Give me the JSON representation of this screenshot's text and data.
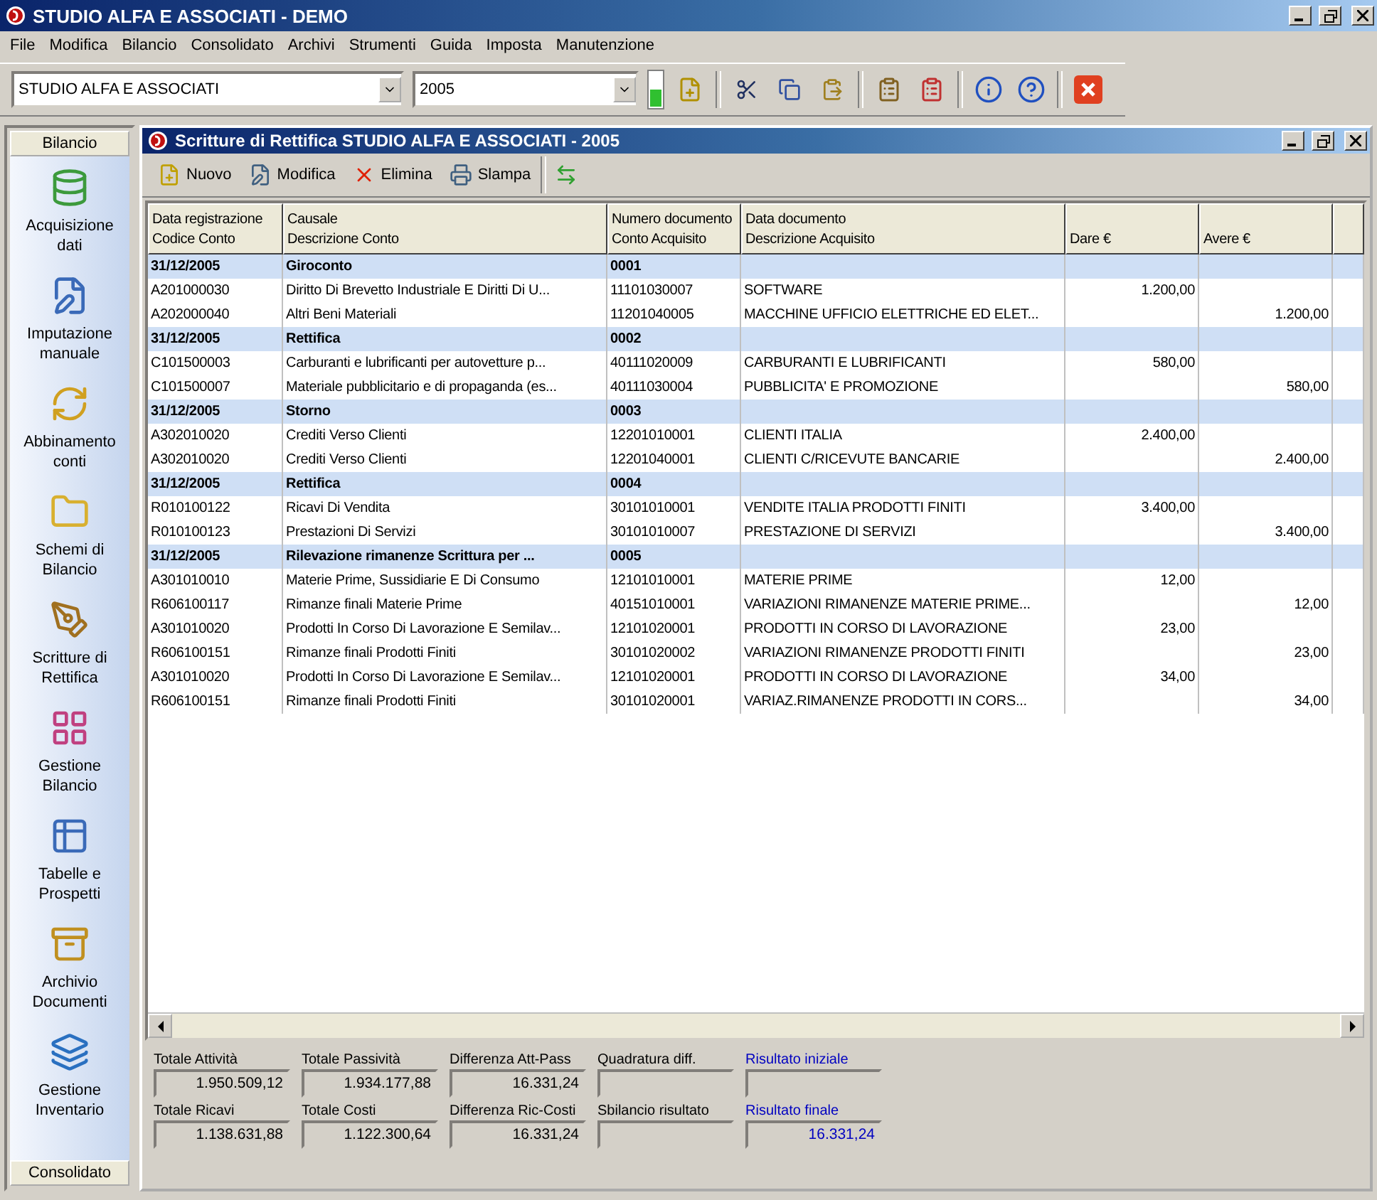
{
  "window": {
    "title": "STUDIO ALFA E ASSOCIATI - DEMO"
  },
  "menu": [
    "File",
    "Modifica",
    "Bilancio",
    "Consolidato",
    "Archivi",
    "Strumenti",
    "Guida",
    "Imposta",
    "Manutenzione"
  ],
  "toolbar": {
    "company": "STUDIO ALFA E ASSOCIATI",
    "year": "2005"
  },
  "sidebar": {
    "header": "Bilancio",
    "footer": "Consolidato",
    "items": [
      {
        "label": "Acquisizione dati"
      },
      {
        "label": "Imputazione manuale"
      },
      {
        "label": "Abbinamento conti"
      },
      {
        "label": "Schemi di Bilancio"
      },
      {
        "label": "Scritture di Rettifica"
      },
      {
        "label": "Gestione Bilancio"
      },
      {
        "label": "Tabelle e Prospetti"
      },
      {
        "label": "Archivio Documenti"
      },
      {
        "label": "Gestione Inventario"
      }
    ]
  },
  "child_window": {
    "title": "Scritture di Rettifica STUDIO ALFA E ASSOCIATI - 2005",
    "toolbar": [
      "Nuovo",
      "Modifica",
      "Elimina",
      "Slampa"
    ],
    "table": {
      "columns": [
        {
          "line1": "Data registrazione",
          "line2": "Codice Conto"
        },
        {
          "line1": "Causale",
          "line2": "Descrizione Conto"
        },
        {
          "line1": "Numero documento",
          "line2": "Conto Acquisito"
        },
        {
          "line1": "Data documento",
          "line2": "Descrizione Acquisito"
        },
        {
          "line2": "Dare €"
        },
        {
          "line2": "Avere €"
        }
      ],
      "rows": [
        {
          "kind": "group",
          "cells": [
            "31/12/2005",
            "Giroconto",
            "0001",
            "",
            "",
            ""
          ]
        },
        {
          "kind": "detail",
          "cells": [
            "A201000030",
            "Diritto Di Brevetto Industriale  E Diritti Di U...",
            "11101030007",
            "SOFTWARE",
            "1.200,00",
            ""
          ]
        },
        {
          "kind": "detail",
          "cells": [
            "A202000040",
            "Altri Beni Materiali",
            "11201040005",
            "MACCHINE UFFICIO ELETTRICHE ED ELET...",
            "",
            "1.200,00"
          ]
        },
        {
          "kind": "group",
          "cells": [
            "31/12/2005",
            "Rettifica",
            "0002",
            "",
            "",
            ""
          ]
        },
        {
          "kind": "detail",
          "cells": [
            "C101500003",
            "Carburanti e lubrificanti per autovetture p...",
            "40111020009",
            "CARBURANTI E LUBRIFICANTI",
            "580,00",
            ""
          ]
        },
        {
          "kind": "detail",
          "cells": [
            "C101500007",
            "Materiale pubblicitario e di propaganda (es...",
            "40111030004",
            "PUBBLICITA' E PROMOZIONE",
            "",
            "580,00"
          ]
        },
        {
          "kind": "group",
          "cells": [
            "31/12/2005",
            "Storno",
            "0003",
            "",
            "",
            ""
          ]
        },
        {
          "kind": "detail",
          "cells": [
            "A302010020",
            "Crediti Verso Clienti",
            "12201010001",
            "CLIENTI ITALIA",
            "2.400,00",
            ""
          ]
        },
        {
          "kind": "detail",
          "cells": [
            "A302010020",
            "Crediti Verso Clienti",
            "12201040001",
            "CLIENTI C/RICEVUTE BANCARIE",
            "",
            "2.400,00"
          ]
        },
        {
          "kind": "group",
          "cells": [
            "31/12/2005",
            "Rettifica",
            "0004",
            "",
            "",
            ""
          ]
        },
        {
          "kind": "detail",
          "cells": [
            "R010100122",
            "Ricavi Di Vendita",
            "30101010001",
            "VENDITE ITALIA PRODOTTI FINITI",
            "3.400,00",
            ""
          ]
        },
        {
          "kind": "detail",
          "cells": [
            "R010100123",
            "Prestazioni Di Servizi",
            "30101010007",
            "PRESTAZIONE DI SERVIZI",
            "",
            "3.400,00"
          ]
        },
        {
          "kind": "group",
          "cells": [
            "31/12/2005",
            "Rilevazione rimanenze Scrittura per ...",
            "0005",
            "",
            "",
            ""
          ]
        },
        {
          "kind": "detail",
          "cells": [
            "A301010010",
            "Materie Prime, Sussidiarie E Di Consumo",
            "12101010001",
            "MATERIE PRIME",
            "12,00",
            ""
          ]
        },
        {
          "kind": "detail",
          "cells": [
            "R606100117",
            "Rimanze finali Materie Prime",
            "40151010001",
            "VARIAZIONI RIMANENZE MATERIE PRIME...",
            "",
            "12,00"
          ]
        },
        {
          "kind": "detail",
          "cells": [
            "A301010020",
            "Prodotti In Corso Di Lavorazione E Semilav...",
            "12101020001",
            "PRODOTTI IN CORSO DI LAVORAZIONE",
            "23,00",
            ""
          ]
        },
        {
          "kind": "detail",
          "cells": [
            "R606100151",
            "Rimanze finali Prodotti Finiti",
            "30101020002",
            "VARIAZIONI RIMANENZE PRODOTTI FINITI",
            "",
            "23,00"
          ]
        },
        {
          "kind": "detail",
          "cells": [
            "A301010020",
            "Prodotti In Corso Di Lavorazione E Semilav...",
            "12101020001",
            "PRODOTTI IN CORSO DI LAVORAZIONE",
            "34,00",
            ""
          ]
        },
        {
          "kind": "detail",
          "cells": [
            "R606100151",
            "Rimanze finali Prodotti Finiti",
            "30101020001",
            "VARIAZ.RIMANENZE PRODOTTI IN CORS...",
            "",
            "34,00"
          ]
        }
      ]
    },
    "totals": [
      {
        "label": "Totale Attività",
        "value": "1.950.509,12",
        "kind": "total"
      },
      {
        "label": "Totale Passività",
        "value": "1.934.177,88",
        "kind": "total"
      },
      {
        "label": "Differenza Att-Pass",
        "value": "16.331,24",
        "kind": "total"
      },
      {
        "label": "Quadratura diff.",
        "kind": "total"
      },
      {
        "label": "Risultato iniziale",
        "kind": "result"
      },
      {
        "label": "Totale Ricavi",
        "value": "1.138.631,88",
        "kind": "total"
      },
      {
        "label": "Totale Costi",
        "value": "1.122.300,64",
        "kind": "total"
      },
      {
        "label": "Differenza Ric-Costi",
        "value": "16.331,24",
        "kind": "total"
      },
      {
        "label": "Sbilancio risultato",
        "kind": "total"
      },
      {
        "label": "Risultato finale",
        "value": "16.331,24",
        "kind": "result"
      }
    ]
  }
}
